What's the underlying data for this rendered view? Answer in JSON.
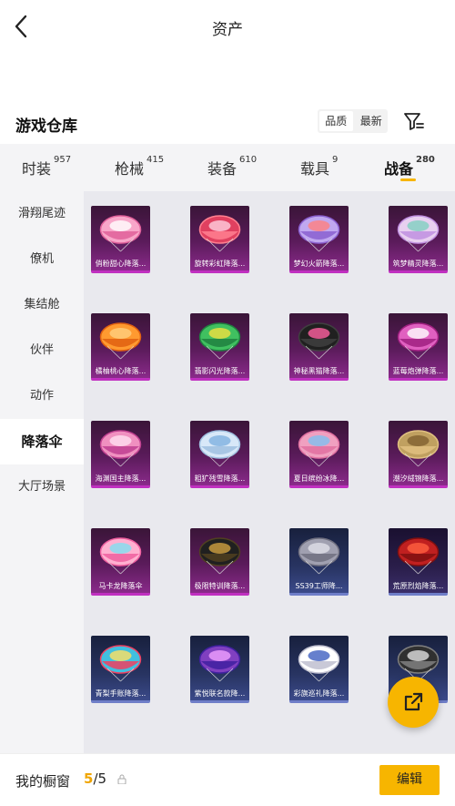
{
  "header": {
    "title": "资产"
  },
  "section": {
    "title": "游戏仓库",
    "sort_options": [
      "品质",
      "最新"
    ]
  },
  "tabs": [
    {
      "label": "时装",
      "count": "957"
    },
    {
      "label": "枪械",
      "count": "415"
    },
    {
      "label": "装备",
      "count": "610"
    },
    {
      "label": "载具",
      "count": "9"
    },
    {
      "label": "战备",
      "count": "280",
      "active": true
    }
  ],
  "sidebar": {
    "items": [
      "滑翔尾迹",
      "僚机",
      "集结舱",
      "伙伴",
      "动作",
      "降落伞",
      "大厅场景"
    ],
    "active_index": 5
  },
  "items": [
    {
      "label": "俏粉甜心降落...",
      "tier": "purple",
      "icon": "parachute-pink-icon"
    },
    {
      "label": "旋转彩虹降落...",
      "tier": "purple",
      "icon": "parachute-red-icon"
    },
    {
      "label": "梦幻火箭降落...",
      "tier": "purple",
      "icon": "parachute-rocket-icon"
    },
    {
      "label": "筑梦精灵降落...",
      "tier": "purple",
      "icon": "parachute-teal-icon"
    },
    {
      "label": "橘柚桃心降落...",
      "tier": "purple",
      "icon": "parachute-orange-icon"
    },
    {
      "label": "翡影闪光降落...",
      "tier": "purple",
      "icon": "parachute-green-icon"
    },
    {
      "label": "神秘黑猫降落...",
      "tier": "purple",
      "icon": "parachute-cat-icon"
    },
    {
      "label": "蓝莓炮弹降落...",
      "tier": "purple",
      "icon": "parachute-magenta-icon"
    },
    {
      "label": "海渊国主降落...",
      "tier": "purple",
      "icon": "parachute-shell-icon"
    },
    {
      "label": "粗犷残雪降落...",
      "tier": "purple",
      "icon": "parachute-snow-icon"
    },
    {
      "label": "夏日缤纷冰降...",
      "tier": "purple",
      "icon": "parachute-summer-icon"
    },
    {
      "label": "潮汐绒锦降落...",
      "tier": "purple",
      "icon": "parachute-gold-icon"
    },
    {
      "label": "马卡龙降落伞",
      "tier": "purple",
      "icon": "parachute-macaron-icon"
    },
    {
      "label": "极限特训降落...",
      "tier": "purple",
      "icon": "parachute-black-gold-icon"
    },
    {
      "label": "SS39工师降...",
      "tier": "blue",
      "icon": "parachute-grey-icon"
    },
    {
      "label": "荒原烈焰降落...",
      "tier": "red",
      "icon": "parachute-flame-icon"
    },
    {
      "label": "青梨手账降落...",
      "tier": "blue",
      "icon": "parachute-notebook-icon"
    },
    {
      "label": "紫悦联名款降...",
      "tier": "blue",
      "icon": "parachute-purple-icon"
    },
    {
      "label": "彩旗巡礼降落...",
      "tier": "blue",
      "icon": "parachute-flags-icon"
    },
    {
      "label": "",
      "tier": "blue",
      "icon": "parachute-dark-icon"
    }
  ],
  "colors": {
    "accent": "#f7b500",
    "purple_tier": "#c030c0",
    "blue_tier": "#6f7ec8"
  },
  "bottom_bar": {
    "label": "我的橱窗",
    "count_current": "5",
    "count_total": "/5",
    "lock_glyph": "🔒",
    "edit_label": "编辑"
  }
}
